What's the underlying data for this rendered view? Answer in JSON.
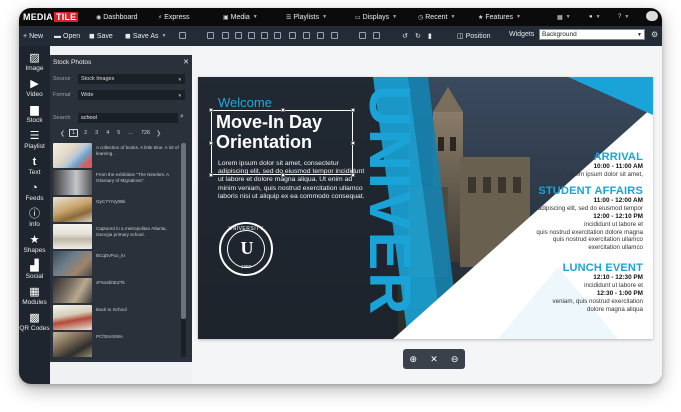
{
  "brand": {
    "part1": "MEDIA",
    "part2": "TILE"
  },
  "nav": {
    "dashboard": "Dashboard",
    "express": "Express",
    "media": "Media",
    "playlists": "Playlists",
    "displays": "Displays",
    "recent": "Recent",
    "features": "Features"
  },
  "toolbar": {
    "new": "New",
    "open": "Open",
    "save": "Save",
    "save_as": "Save As",
    "position": "Position",
    "widgets_label": "Widgets",
    "widgets_value": "Background"
  },
  "rail": [
    "Image",
    "Video",
    "Stock",
    "Playlist",
    "Text",
    "Feeds",
    "Info",
    "Shapes",
    "Social",
    "Modules",
    "QR Codes"
  ],
  "panel": {
    "title": "Stock Photos",
    "source_label": "Source",
    "source_value": "Stock Images",
    "format_label": "Format",
    "format_value": "Wide",
    "search_label": "Search",
    "search_value": "school",
    "pages": [
      "1",
      "2",
      "3",
      "4",
      "5",
      "...",
      "726"
    ],
    "results": [
      "A collection of books. A little time. A lot of learning.",
      "From the exhibition \"The Nineties: A Glossary of Migrations\".",
      "OyC7YrVy0Bk",
      "Captured in a metropolitan Atlanta, Georgia primary school.",
      "BCqDvPuo_kI",
      "zF5o6bhEZTk",
      "Back to School",
      "PCfI3mISWA"
    ]
  },
  "slide": {
    "welcome": "Welcome",
    "heading_line1": "Move-In Day",
    "heading_line2": "Orientation",
    "lorem": "Lorem ipsum dolor sit amet, consectetur adipiscing elit, sed do eiusmod tempor incididunt ut labore et dolore magna aliqua. Ut enim ad minim veniam, quis nostrud exercitation ullamco laboris nisi ut aliquip ex ea commodo consequat.",
    "seal_top": "UNIVERSITY",
    "seal_letter": "U",
    "seal_year": "1980",
    "big_word": "UNIVER",
    "arrival_title": "ARRIVAL",
    "arrival_time": "10:00 - 11:00 AM",
    "arrival_desc": "Lorem ipsum dolor sit amet,",
    "student_title": "STUDENT AFFAIRS",
    "student_time1": "11:00 - 12:00 AM",
    "student_desc1": "adipiscing elit, sed do eiusmod tempor",
    "student_time2": "12:00 - 12:10 PM",
    "student_desc2a": "incididunt ut labore et",
    "student_desc2b": "quis nostrud exercitation dolore magna",
    "student_desc2c": "quis nostrud exercitation ullamco",
    "student_desc2d": "exercitation ullamco",
    "lunch_title": "LUNCH EVENT",
    "lunch_time1": "12:10 - 12:30 PM",
    "lunch_desc1": "incididunt ut labore et",
    "lunch_time2": "12:30 - 1:00 PM",
    "lunch_desc2a": "veniam, quis nostrud exercitation",
    "lunch_desc2b": "dolore magna aliqua"
  },
  "colors": {
    "accent": "#1aa3d6",
    "brand_red": "#d81f2c",
    "topbar": "#0b0b0c",
    "toolbar": "#232b37"
  }
}
